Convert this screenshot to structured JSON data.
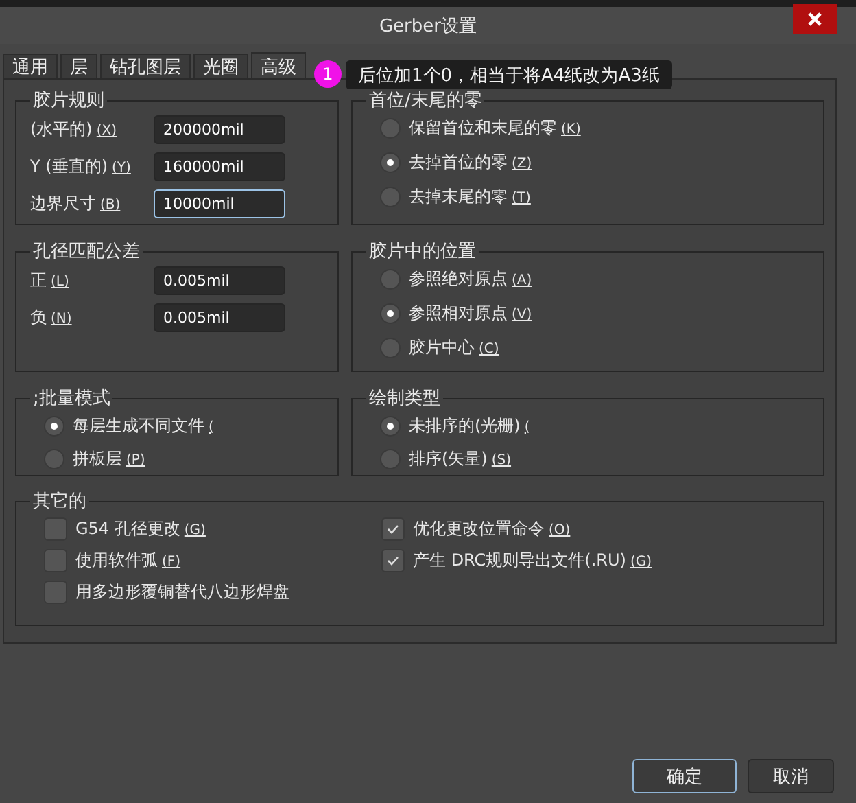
{
  "window": {
    "title": "Gerber设置"
  },
  "tabs": [
    {
      "label": "通用",
      "selected": false
    },
    {
      "label": "层",
      "selected": false
    },
    {
      "label": "钻孔图层",
      "selected": false
    },
    {
      "label": "光圈",
      "selected": false
    },
    {
      "label": "高级",
      "selected": true
    }
  ],
  "groups": [
    {
      "title": "胶片规则",
      "kind": "fields",
      "items": [
        {
          "label": "(水平的)",
          "hotkey": "(X)",
          "value": "200000mil",
          "focused": false
        },
        {
          "label": "Y (垂直的)",
          "hotkey": "(Y)",
          "value": "160000mil",
          "focused": false
        },
        {
          "label": "边界尺寸",
          "hotkey": "(B)",
          "value": "10000mil",
          "focused": true
        }
      ]
    },
    {
      "title": "首位/末尾的零",
      "kind": "radios",
      "items": [
        {
          "label": "保留首位和末尾的零",
          "hotkey": "(K)",
          "selected": false
        },
        {
          "label": "去掉首位的零",
          "hotkey": "(Z)",
          "selected": true
        },
        {
          "label": "去掉末尾的零",
          "hotkey": "(T)",
          "selected": false
        }
      ]
    },
    {
      "title": "孔径匹配公差",
      "kind": "fields",
      "items": [
        {
          "label": "正",
          "hotkey": "(L)",
          "value": "0.005mil",
          "focused": false
        },
        {
          "label": "负",
          "hotkey": "(N)",
          "value": "0.005mil",
          "focused": false
        }
      ]
    },
    {
      "title": "胶片中的位置",
      "kind": "radios",
      "items": [
        {
          "label": "参照绝对原点",
          "hotkey": "(A)",
          "selected": false
        },
        {
          "label": "参照相对原点",
          "hotkey": "(V)",
          "selected": true
        },
        {
          "label": "胶片中心",
          "hotkey": "(C)",
          "selected": false
        }
      ]
    },
    {
      "title": ";批量模式",
      "kind": "radios",
      "items": [
        {
          "label": "每层生成不同文件",
          "hotkey": "(",
          "selected": true
        },
        {
          "label": "拼板层",
          "hotkey": "(P)",
          "selected": false
        }
      ]
    },
    {
      "title": "绘制类型",
      "kind": "radios",
      "items": [
        {
          "label": "未排序的(光栅)",
          "hotkey": "(",
          "selected": true
        },
        {
          "label": "排序(矢量)",
          "hotkey": "(S)",
          "selected": false
        }
      ]
    }
  ],
  "other": {
    "title": "其它的",
    "columns": [
      [
        {
          "label": "G54 孔径更改",
          "hotkey": "(G)",
          "checked": false
        },
        {
          "label": "使用软件弧",
          "hotkey": "(F)",
          "checked": false
        },
        {
          "label": "用多边形覆铜替代八边形焊盘",
          "checked": false
        }
      ],
      [
        {
          "label": "优化更改位置命令",
          "hotkey": "(O)",
          "checked": true
        },
        {
          "label": "产生 DRC规则导出文件(.RU)",
          "hotkey": "(G)",
          "checked": true
        }
      ]
    ]
  },
  "tooltip": {
    "badge": "1",
    "text": "后位加1个0，相当于将A4纸改为A3纸"
  },
  "buttons": [
    {
      "label": "确定",
      "default": true
    },
    {
      "label": "取消",
      "default": false
    }
  ]
}
